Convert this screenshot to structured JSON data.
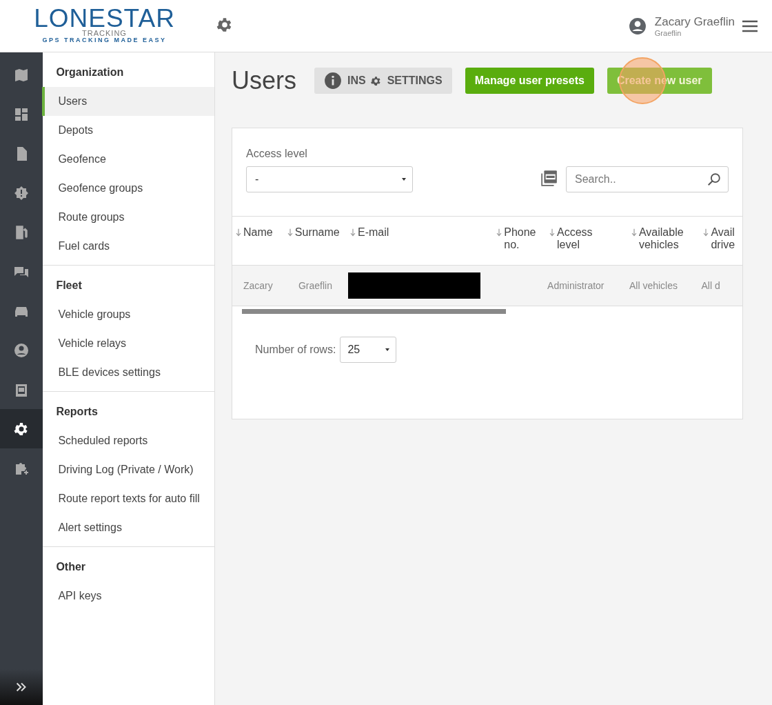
{
  "header": {
    "logo": {
      "name": "LONESTAR",
      "sub": "TRACKING",
      "tagline": "GPS TRACKING MADE EASY"
    },
    "user": {
      "name": "Zacary Graeflin",
      "account": "Graeflin"
    }
  },
  "rail": [
    {
      "selected": false
    },
    {
      "selected": false
    },
    {
      "selected": false
    },
    {
      "selected": false
    },
    {
      "selected": false
    },
    {
      "selected": false
    },
    {
      "selected": false
    },
    {
      "selected": false
    },
    {
      "selected": false
    },
    {
      "selected": true
    },
    {
      "selected": false
    }
  ],
  "sidebar": [
    {
      "heading": "Organization",
      "items": [
        {
          "label": "Users",
          "selected": true
        },
        {
          "label": "Depots",
          "selected": false
        },
        {
          "label": "Geofence",
          "selected": false
        },
        {
          "label": "Geofence groups",
          "selected": false
        },
        {
          "label": "Route groups",
          "selected": false
        },
        {
          "label": "Fuel cards",
          "selected": false
        }
      ]
    },
    {
      "heading": "Fleet",
      "items": [
        {
          "label": "Vehicle groups",
          "selected": false
        },
        {
          "label": "Vehicle relays",
          "selected": false
        },
        {
          "label": "BLE devices settings",
          "selected": false
        }
      ]
    },
    {
      "heading": "Reports",
      "items": [
        {
          "label": "Scheduled reports",
          "selected": false
        },
        {
          "label": "Driving Log (Private / Work)",
          "selected": false
        },
        {
          "label": "Route report texts for auto fill",
          "selected": false
        },
        {
          "label": "Alert settings",
          "selected": false
        }
      ]
    },
    {
      "heading": "Other",
      "items": [
        {
          "label": "API keys",
          "selected": false
        }
      ]
    }
  ],
  "page": {
    "title": "Users",
    "info_button": "INS",
    "settings_button": "SETTINGS",
    "buttons": [
      {
        "label": "Manage user presets",
        "kind": "primary"
      },
      {
        "label": "Create new user",
        "kind": "highlighted"
      }
    ]
  },
  "filters": {
    "access_level": {
      "label": "Access level",
      "value": "-"
    },
    "search": {
      "placeholder": "Search.."
    }
  },
  "table": {
    "columns": [
      "Name",
      "Surname",
      "E-mail",
      "Phone no.",
      "Access level",
      "Available vehicles",
      "Avail drive"
    ],
    "rows": [
      {
        "cells": [
          {
            "kind": "text",
            "text": "Zacary"
          },
          {
            "kind": "text",
            "text": "Graeflin"
          },
          {
            "kind": "redacted"
          },
          {
            "kind": "empty"
          },
          {
            "kind": "text",
            "text": "Administrator"
          },
          {
            "kind": "text",
            "text": "All vehicles"
          },
          {
            "kind": "text",
            "text": "All d"
          }
        ]
      }
    ]
  },
  "pagination": {
    "label": "Number of rows:",
    "value": "25"
  }
}
